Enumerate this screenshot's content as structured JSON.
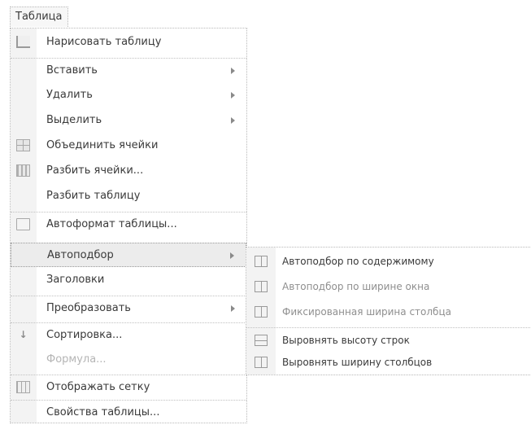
{
  "menubar": {
    "title": "Таблица"
  },
  "menu": {
    "items": [
      {
        "label": "Нарисовать таблицу",
        "icon": "pencil-icon"
      },
      {
        "label": "Вставить",
        "submenu": true
      },
      {
        "label": "Удалить",
        "submenu": true
      },
      {
        "label": "Выделить",
        "submenu": true
      },
      {
        "label": "Объединить ячейки",
        "icon": "merge-cells-icon"
      },
      {
        "label": "Разбить ячейки...",
        "icon": "split-cells-icon"
      },
      {
        "label": "Разбить таблицу"
      },
      {
        "label": "Автоформат таблицы...",
        "icon": "autoformat-icon"
      },
      {
        "label": "Автоподбор",
        "submenu": true
      },
      {
        "label": "Заголовки"
      },
      {
        "label": "Преобразовать",
        "submenu": true
      },
      {
        "label": "Сортировка...",
        "icon": "sort-icon"
      },
      {
        "label": "Формула..."
      },
      {
        "label": "Отображать сетку",
        "icon": "show-grid-icon"
      },
      {
        "label": "Свойства таблицы..."
      }
    ]
  },
  "submenu": {
    "items": [
      {
        "label": "Автоподбор по содержимому",
        "icon": "autofit-content-icon"
      },
      {
        "label": "Автоподбор по ширине окна",
        "icon": "autofit-window-icon"
      },
      {
        "label": "Фиксированная ширина столбца",
        "icon": "fixed-width-icon"
      },
      {
        "label": "Выровнять высоту строк",
        "icon": "distribute-rows-icon"
      },
      {
        "label": "Выровнять ширину столбцов",
        "icon": "distribute-columns-icon"
      }
    ]
  },
  "colors": {
    "menu_bg": "#ffffff",
    "icon_column": "#f3f3f3",
    "highlight": "#ececec",
    "disabled_text": "#b5b5b5"
  }
}
